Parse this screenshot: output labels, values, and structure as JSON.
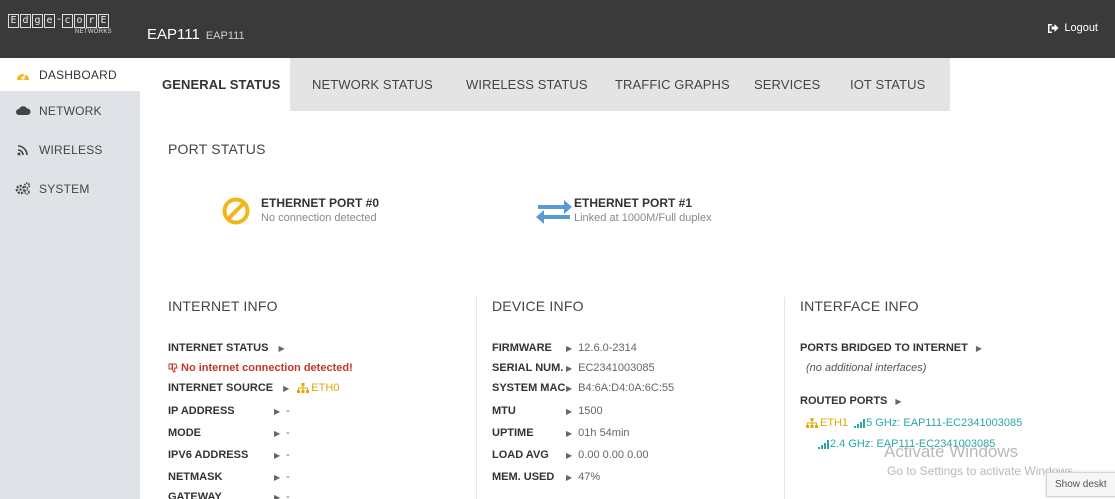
{
  "header": {
    "logo_letters": [
      "E",
      "d",
      "g",
      "e",
      "-",
      "c",
      "o",
      "r",
      "E"
    ],
    "logo_sub": "NETWORKS",
    "device_name": "EAP111",
    "device_sub": "EAP111",
    "logout_label": "Logout"
  },
  "sidebar": {
    "items": [
      {
        "label": "DASHBOARD",
        "icon": "dashboard-icon"
      },
      {
        "label": "NETWORK",
        "icon": "cloud-icon"
      },
      {
        "label": "WIRELESS",
        "icon": "wireless-icon"
      },
      {
        "label": "SYSTEM",
        "icon": "gears-icon"
      }
    ]
  },
  "tabs": [
    {
      "label": "GENERAL STATUS"
    },
    {
      "label": "NETWORK STATUS"
    },
    {
      "label": "WIRELESS STATUS"
    },
    {
      "label": "TRAFFIC GRAPHS"
    },
    {
      "label": "SERVICES"
    },
    {
      "label": "IOT STATUS"
    }
  ],
  "port_status": {
    "title": "PORT STATUS",
    "port0": {
      "name": "ETHERNET PORT #0",
      "desc": "No connection detected"
    },
    "port1": {
      "name": "ETHERNET PORT #1",
      "desc": "Linked at 1000M/Full duplex"
    }
  },
  "internet_info": {
    "title": "INTERNET INFO",
    "status_label": "INTERNET STATUS",
    "status_error": "No internet connection detected!",
    "source_label": "INTERNET SOURCE",
    "source_value": "ETH0",
    "rows": [
      {
        "label": "IP ADDRESS",
        "value": "-"
      },
      {
        "label": "MODE",
        "value": "-"
      },
      {
        "label": "IPV6 ADDRESS",
        "value": "-"
      },
      {
        "label": "NETMASK",
        "value": "-"
      },
      {
        "label": "GATEWAY",
        "value": "-"
      }
    ]
  },
  "device_info": {
    "title": "DEVICE INFO",
    "rows": [
      {
        "label": "FIRMWARE",
        "value": "12.6.0-2314"
      },
      {
        "label": "SERIAL NUM.",
        "value": "EC2341003085"
      },
      {
        "label": "SYSTEM MAC",
        "value": "B4:6A:D4:0A:6C:55"
      },
      {
        "label": "MTU",
        "value": "1500"
      },
      {
        "label": "UPTIME",
        "value": "01h 54min"
      },
      {
        "label": "LOAD AVG",
        "value": "0.00 0.00 0.00"
      },
      {
        "label": "MEM. USED",
        "value": "47%"
      }
    ]
  },
  "interface_info": {
    "title": "INTERFACE INFO",
    "bridged_label": "PORTS BRIDGED TO INTERNET",
    "bridged_note": "(no additional interfaces)",
    "routed_label": "ROUTED PORTS",
    "eth1": "ETH1",
    "wifi5": "5 GHz: EAP111-EC2341003085",
    "wifi24": "2.4 GHz: EAP111-EC2341003085"
  },
  "os_overlay": {
    "activate_title": "Activate Windows",
    "activate_sub": "Go to Settings to activate Windows.",
    "show_desktop": "Show deskt"
  },
  "colors": {
    "topbar": "#3a3a3a",
    "sidebar": "#dfe3e7",
    "tabs": "#e4e4e4",
    "warning": "#f2b51c",
    "link_blue": "#5b9bd5",
    "error": "#c0392b",
    "wifi": "#2aa7a7"
  }
}
